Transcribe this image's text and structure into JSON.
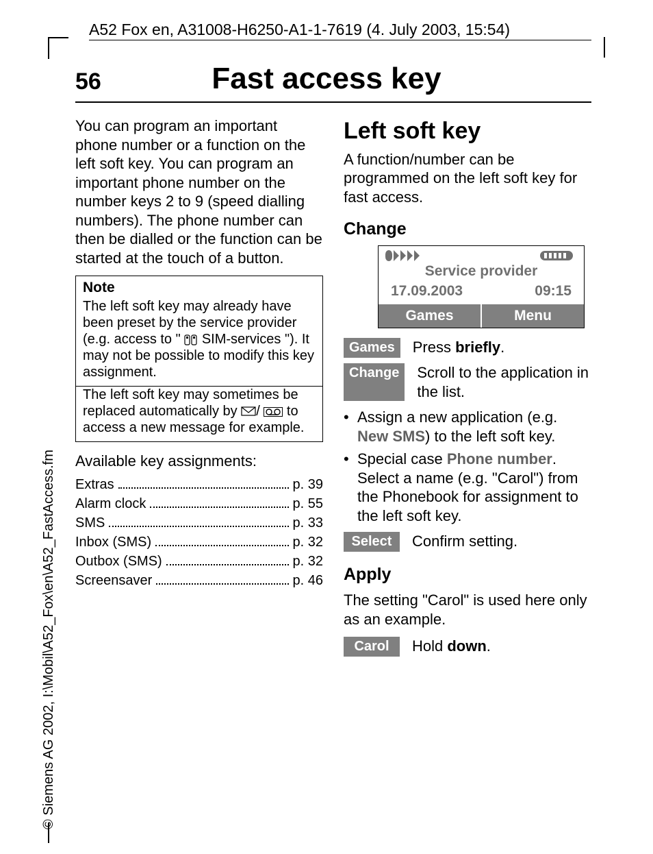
{
  "header": {
    "doc_line": "A52 Fox en, A31008-H6250-A1-1-7619 (4. July 2003, 15:54)",
    "page_number": "56",
    "chapter_title": "Fast access key"
  },
  "copyright": "© Siemens AG 2002, I:\\Mobil\\A52_Fox\\en\\A52_FastAccess.fm",
  "left": {
    "intro": "You can program an important phone number or a function on the left soft key. You can program an important phone number on the number keys 2 to 9 (speed dialling numbers). The phone number can then be dialled or the function can be started at the touch of a button.",
    "note_title": "Note",
    "note_body_1a": "The left soft key may already have been preset by the service provider (e.g. access to \"",
    "note_body_1b": " SIM-services \"). It may not be possible to modify this key assignment.",
    "note_body_2a": "The left soft key may sometimes be replaced automatically by ",
    "note_body_2b": " to access a new message for example.",
    "available_label": "Available key assignments:",
    "assignments": [
      {
        "name": "Extras",
        "page": "p. 39"
      },
      {
        "name": "Alarm clock",
        "page": "p. 55"
      },
      {
        "name": "SMS",
        "page": "p. 33"
      },
      {
        "name": "Inbox (SMS)",
        "page": "p. 32"
      },
      {
        "name": "Outbox (SMS)",
        "page": "p. 32"
      },
      {
        "name": "Screensaver",
        "page": "p. 46"
      }
    ]
  },
  "right": {
    "section_title": "Left soft key",
    "section_intro": "A function/number can be programmed on the left soft key for fast access.",
    "change_title": "Change",
    "phone": {
      "provider": "Service provider",
      "date": "17.09.2003",
      "time": "09:15",
      "left_soft": "Games",
      "right_soft": "Menu"
    },
    "step_games_label": "Games",
    "step_games_text_a": "Press ",
    "step_games_text_b": "briefly",
    "step_games_text_c": ".",
    "step_change_label": "Change",
    "step_change_text": "Scroll to the application in the list.",
    "bullet1_a": "Assign a new application (e.g. ",
    "bullet1_b": "New SMS",
    "bullet1_c": ") to the left soft key.",
    "bullet2_a": "Special case ",
    "bullet2_b": "Phone number",
    "bullet2_c": ". Select a name (e.g. \"Carol\") from the Phonebook for assignment to the left soft key.",
    "step_select_label": "Select",
    "step_select_text": "Confirm setting.",
    "apply_title": "Apply",
    "apply_intro": "The setting \"Carol\" is used here only as an example.",
    "step_carol_label": "Carol",
    "step_carol_text_a": "Hold ",
    "step_carol_text_b": "down",
    "step_carol_text_c": "."
  }
}
